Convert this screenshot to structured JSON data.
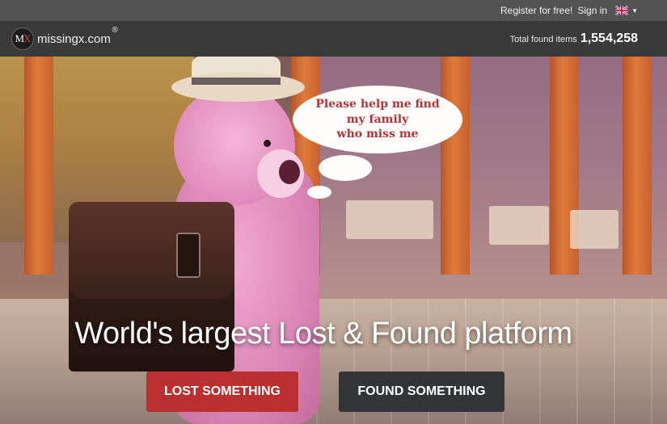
{
  "topbar": {
    "register_label": "Register for free!",
    "signin_label": "Sign in",
    "language_icon": "uk-flag-icon"
  },
  "header": {
    "logo_badge_m": "M",
    "logo_badge_x": "X",
    "logo_text": "missingx.com",
    "logo_reg": "®",
    "total_label": "Total found items",
    "total_value": "1,554,258"
  },
  "hero": {
    "speech_line1": "Please help me find",
    "speech_line2": "my family",
    "speech_line3": "who miss me",
    "headline": "World's largest Lost & Found platform",
    "lost_button": "LOST SOMETHING",
    "found_button": "FOUND SOMETHING"
  },
  "colors": {
    "accent_red": "#bb2f31",
    "dark_button": "#333436",
    "speech_text": "#b4333b"
  }
}
